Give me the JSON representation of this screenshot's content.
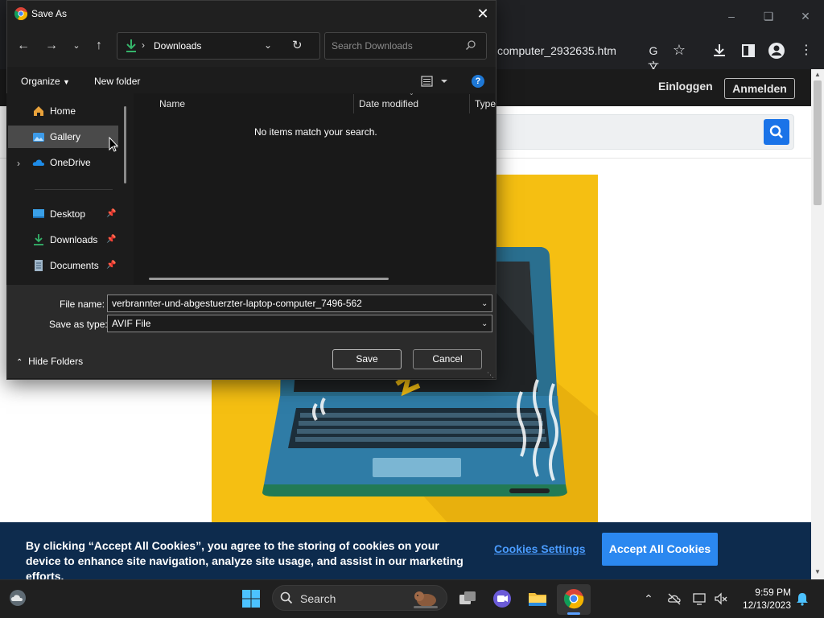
{
  "browser": {
    "url_fragment": "computer_2932635.htm",
    "login_label": "Einloggen",
    "register_label": "Anmelden"
  },
  "cookie_banner": {
    "text": "By clicking “Accept All Cookies”, you agree to the storing of cookies on your device to enhance site navigation, analyze site usage, and assist in our marketing efforts.",
    "settings_label": "Cookies Settings",
    "accept_label": "Accept All Cookies"
  },
  "dialog": {
    "title": "Save As",
    "address_folder": "Downloads",
    "search_placeholder": "Search Downloads",
    "organize_label": "Organize",
    "new_folder_label": "New folder",
    "nav_items": [
      {
        "label": "Home",
        "icon": "home-icon"
      },
      {
        "label": "Gallery",
        "icon": "gallery-icon",
        "selected": true
      },
      {
        "label": "OneDrive",
        "icon": "onedrive-icon"
      },
      {
        "label": "Desktop",
        "icon": "desktop-icon",
        "pinned": true
      },
      {
        "label": "Downloads",
        "icon": "downloads-icon",
        "pinned": true
      },
      {
        "label": "Documents",
        "icon": "documents-icon",
        "pinned": true
      }
    ],
    "columns": [
      "Name",
      "Date modified",
      "Type"
    ],
    "empty_message": "No items match your search.",
    "file_name_label": "File name:",
    "file_name_value": "verbrannter-und-abgestuerzter-laptop-computer_7496-562",
    "save_type_label": "Save as type:",
    "save_type_value": "AVIF File",
    "hide_folders_label": "Hide Folders",
    "save_label": "Save",
    "cancel_label": "Cancel"
  },
  "taskbar": {
    "search_label": "Search",
    "time": "9:59 PM",
    "date": "12/13/2023"
  },
  "colors": {
    "accent": "#2b88f0",
    "banner": "#0d2b4d",
    "illustration_bg": "#f5bf12",
    "dialog_bg": "#1c1c1c"
  }
}
